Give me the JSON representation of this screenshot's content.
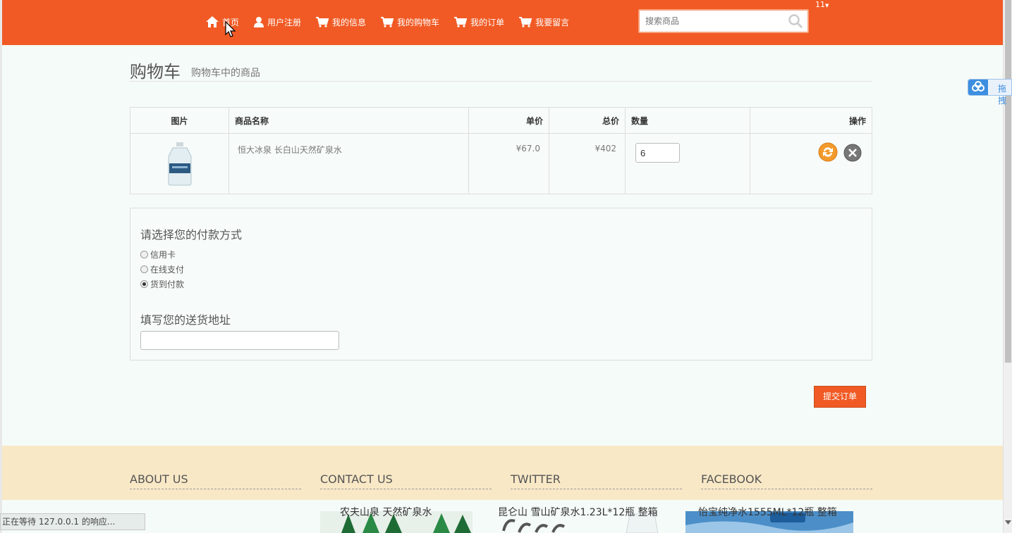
{
  "nav": {
    "items": [
      {
        "label": "首页"
      },
      {
        "label": "用户注册"
      },
      {
        "label": "我的信息"
      },
      {
        "label": "我的购物车"
      },
      {
        "label": "我的订单"
      },
      {
        "label": "我要留言"
      }
    ],
    "search_placeholder": "搜索商品",
    "user_badge": "11"
  },
  "page": {
    "title": "购物车",
    "subtitle": "购物车中的商品"
  },
  "cart": {
    "headers": {
      "image": "图片",
      "name": "商品名称",
      "unit_price": "单价",
      "total": "总价",
      "quantity": "数量",
      "actions": "操作"
    },
    "rows": [
      {
        "name": "恒大冰泉 长白山天然矿泉水",
        "unit_price": "¥67.0",
        "total": "¥402",
        "quantity": "6"
      }
    ]
  },
  "payment": {
    "heading": "请选择您的付款方式",
    "options": [
      {
        "label": "信用卡",
        "selected": false
      },
      {
        "label": "在线支付",
        "selected": false
      },
      {
        "label": "货到付款",
        "selected": true
      }
    ],
    "address_heading": "填写您的送货地址",
    "address_value": ""
  },
  "submit_label": "提交订单",
  "footer": {
    "cols": [
      "ABOUT US",
      "CONTACT US",
      "TWITTER",
      "FACEBOOK"
    ],
    "products": [
      "农夫山泉 天然矿泉水",
      "昆仑山 雪山矿泉水1.23L*12瓶 整箱",
      "怡宝纯净水1555ML*12瓶 整箱"
    ]
  },
  "float_tool_label": "拖拽",
  "status_text": "正在等待 127.0.0.1 的响应...",
  "colors": {
    "brand": "#f15a24",
    "footer_bg": "#f8e8c6"
  }
}
